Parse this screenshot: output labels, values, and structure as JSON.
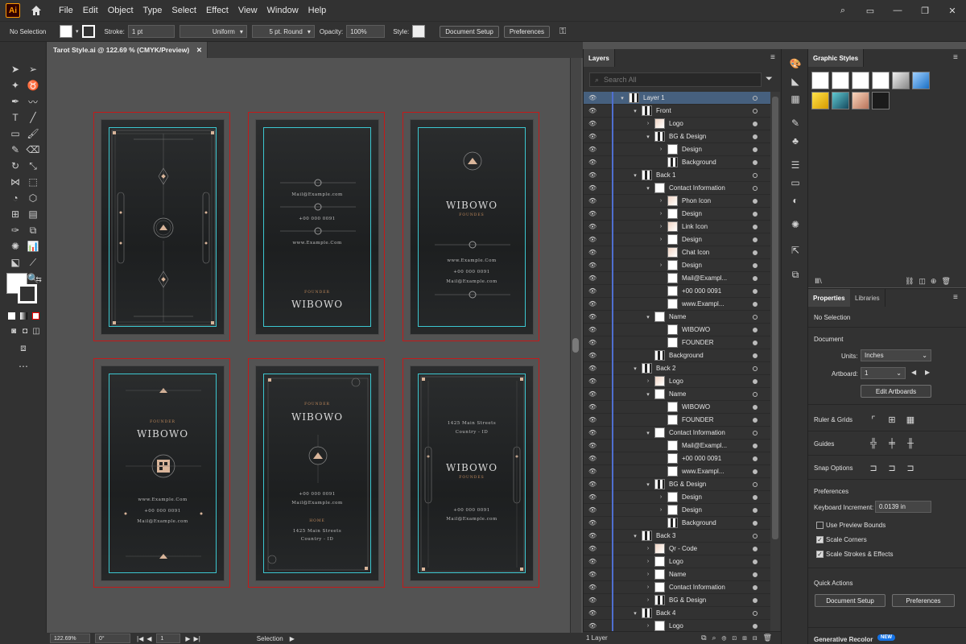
{
  "menubar": {
    "logo": "Ai",
    "items": [
      "File",
      "Edit",
      "Object",
      "Type",
      "Select",
      "Effect",
      "View",
      "Window",
      "Help"
    ]
  },
  "controlbar": {
    "selection": "No Selection",
    "stroke_label": "Stroke:",
    "stroke_value": "1 pt",
    "profile": "Uniform",
    "brush": "5 pt. Round",
    "opacity_label": "Opacity:",
    "opacity_value": "100%",
    "style_label": "Style:",
    "document_setup": "Document Setup",
    "preferences": "Preferences"
  },
  "document": {
    "tab_title": "Tarot Style.ai @ 122.69 % (CMYK/Preview)"
  },
  "cards": {
    "name": "WIBOWO",
    "founder": "FOUNDER",
    "founder_lower": "FOUNDES",
    "mail": "Mail@Example.com",
    "phone": "+00 000 0091",
    "web": "www.Example.Com",
    "address1": "1425 Main Streets",
    "address2": "Country - ID",
    "home": "HOME"
  },
  "statusbar": {
    "zoom": "122.69%",
    "rotation": "0°",
    "artboard": "1",
    "mode": "Selection"
  },
  "layers": {
    "tab": "Layers",
    "search_placeholder": "Search All",
    "footer": "1 Layer",
    "rows": [
      {
        "name": "Layer 1",
        "indent": 0,
        "thumb": "dark",
        "twisty": "v",
        "sel": true,
        "filled": false
      },
      {
        "name": "Front",
        "indent": 1,
        "thumb": "dark",
        "twisty": "v",
        "sel": false,
        "filled": false
      },
      {
        "name": "Logo",
        "indent": 2,
        "thumb": "tan",
        "twisty": ">",
        "sel": false,
        "filled": true
      },
      {
        "name": "BG & Design",
        "indent": 2,
        "thumb": "dark",
        "twisty": "v",
        "sel": false,
        "filled": true
      },
      {
        "name": "Design",
        "indent": 3,
        "thumb": "white",
        "twisty": ">",
        "sel": false,
        "filled": true
      },
      {
        "name": "Background",
        "indent": 3,
        "thumb": "dark",
        "twisty": "",
        "sel": false,
        "filled": true
      },
      {
        "name": "Back 1",
        "indent": 1,
        "thumb": "dark",
        "twisty": "v",
        "sel": false,
        "filled": false
      },
      {
        "name": "Contact Information",
        "indent": 2,
        "thumb": "white",
        "twisty": "v",
        "sel": false,
        "filled": false
      },
      {
        "name": "Phon Icon",
        "indent": 3,
        "thumb": "tan",
        "twisty": ">",
        "sel": false,
        "filled": true
      },
      {
        "name": "Design",
        "indent": 3,
        "thumb": "white",
        "twisty": ">",
        "sel": false,
        "filled": true
      },
      {
        "name": "Link Icon",
        "indent": 3,
        "thumb": "tan",
        "twisty": ">",
        "sel": false,
        "filled": true
      },
      {
        "name": "Design",
        "indent": 3,
        "thumb": "white",
        "twisty": ">",
        "sel": false,
        "filled": true
      },
      {
        "name": "Chat Icon",
        "indent": 3,
        "thumb": "tan",
        "twisty": "",
        "sel": false,
        "filled": true
      },
      {
        "name": "Design",
        "indent": 3,
        "thumb": "white",
        "twisty": ">",
        "sel": false,
        "filled": true
      },
      {
        "name": "Mail@Exampl...",
        "indent": 3,
        "thumb": "white",
        "twisty": "",
        "sel": false,
        "filled": true
      },
      {
        "name": "+00 000 0091",
        "indent": 3,
        "thumb": "white",
        "twisty": "",
        "sel": false,
        "filled": true
      },
      {
        "name": "www.Exampl...",
        "indent": 3,
        "thumb": "white",
        "twisty": "",
        "sel": false,
        "filled": true
      },
      {
        "name": "Name",
        "indent": 2,
        "thumb": "white",
        "twisty": "v",
        "sel": false,
        "filled": false
      },
      {
        "name": "WIBOWO",
        "indent": 3,
        "thumb": "white",
        "twisty": "",
        "sel": false,
        "filled": true
      },
      {
        "name": "FOUNDER",
        "indent": 3,
        "thumb": "white",
        "twisty": "",
        "sel": false,
        "filled": true
      },
      {
        "name": "Background",
        "indent": 2,
        "thumb": "dark",
        "twisty": "",
        "sel": false,
        "filled": true
      },
      {
        "name": "Back 2",
        "indent": 1,
        "thumb": "dark",
        "twisty": "v",
        "sel": false,
        "filled": false
      },
      {
        "name": "Logo",
        "indent": 2,
        "thumb": "tan",
        "twisty": ">",
        "sel": false,
        "filled": true
      },
      {
        "name": "Name",
        "indent": 2,
        "thumb": "white",
        "twisty": "v",
        "sel": false,
        "filled": false
      },
      {
        "name": "WIBOWO",
        "indent": 3,
        "thumb": "white",
        "twisty": "",
        "sel": false,
        "filled": true
      },
      {
        "name": "FOUNDER",
        "indent": 3,
        "thumb": "white",
        "twisty": "",
        "sel": false,
        "filled": true
      },
      {
        "name": "Contact Information",
        "indent": 2,
        "thumb": "white",
        "twisty": "v",
        "sel": false,
        "filled": false
      },
      {
        "name": "Mail@Exampl...",
        "indent": 3,
        "thumb": "white",
        "twisty": "",
        "sel": false,
        "filled": true
      },
      {
        "name": "+00 000 0091",
        "indent": 3,
        "thumb": "white",
        "twisty": "",
        "sel": false,
        "filled": true
      },
      {
        "name": "www.Exampl...",
        "indent": 3,
        "thumb": "white",
        "twisty": "",
        "sel": false,
        "filled": true
      },
      {
        "name": "BG & Design",
        "indent": 2,
        "thumb": "dark",
        "twisty": "v",
        "sel": false,
        "filled": false
      },
      {
        "name": "Design",
        "indent": 3,
        "thumb": "white",
        "twisty": ">",
        "sel": false,
        "filled": true
      },
      {
        "name": "Design",
        "indent": 3,
        "thumb": "white",
        "twisty": ">",
        "sel": false,
        "filled": true
      },
      {
        "name": "Background",
        "indent": 3,
        "thumb": "dark",
        "twisty": "",
        "sel": false,
        "filled": true
      },
      {
        "name": "Back 3",
        "indent": 1,
        "thumb": "dark",
        "twisty": "v",
        "sel": false,
        "filled": false
      },
      {
        "name": "Qr - Code",
        "indent": 2,
        "thumb": "tan",
        "twisty": ">",
        "sel": false,
        "filled": true
      },
      {
        "name": "Logo",
        "indent": 2,
        "thumb": "white",
        "twisty": ">",
        "sel": false,
        "filled": true
      },
      {
        "name": "Name",
        "indent": 2,
        "thumb": "white",
        "twisty": ">",
        "sel": false,
        "filled": true
      },
      {
        "name": "Contact Information",
        "indent": 2,
        "thumb": "white",
        "twisty": ">",
        "sel": false,
        "filled": true
      },
      {
        "name": "BG & Design",
        "indent": 2,
        "thumb": "dark",
        "twisty": ">",
        "sel": false,
        "filled": true
      },
      {
        "name": "Back 4",
        "indent": 1,
        "thumb": "dark",
        "twisty": "v",
        "sel": false,
        "filled": false
      },
      {
        "name": "Logo",
        "indent": 2,
        "thumb": "white",
        "twisty": ">",
        "sel": false,
        "filled": true
      }
    ]
  },
  "graphic_styles": {
    "tab": "Graphic Styles",
    "swatches": [
      "#ffffff",
      "#ffffff",
      "#ffffff",
      "#ffffff",
      "#c8c8c8",
      "#4aa3e8",
      "#f2c418",
      "#2a7d8a",
      "#e8b090",
      "#1b1b1b"
    ]
  },
  "properties": {
    "tab": "Properties",
    "tab2": "Libraries",
    "selection": "No Selection",
    "document": "Document",
    "units_label": "Units:",
    "units_value": "Inches",
    "artboard_label": "Artboard:",
    "artboard_value": "1",
    "edit_artboards": "Edit Artboards",
    "ruler_grids": "Ruler & Grids",
    "guides": "Guides",
    "snap_options": "Snap Options",
    "preferences": "Preferences",
    "keyboard_increment_label": "Keyboard Increment:",
    "keyboard_increment_value": "0.0139 in",
    "use_preview_bounds": "Use Preview Bounds",
    "scale_corners": "Scale Corners",
    "scale_strokes": "Scale Strokes & Effects",
    "quick_actions": "Quick Actions",
    "document_setup": "Document Setup",
    "preferences_btn": "Preferences",
    "generative_recolor": "Generative Recolor",
    "new_badge": "NEW"
  }
}
